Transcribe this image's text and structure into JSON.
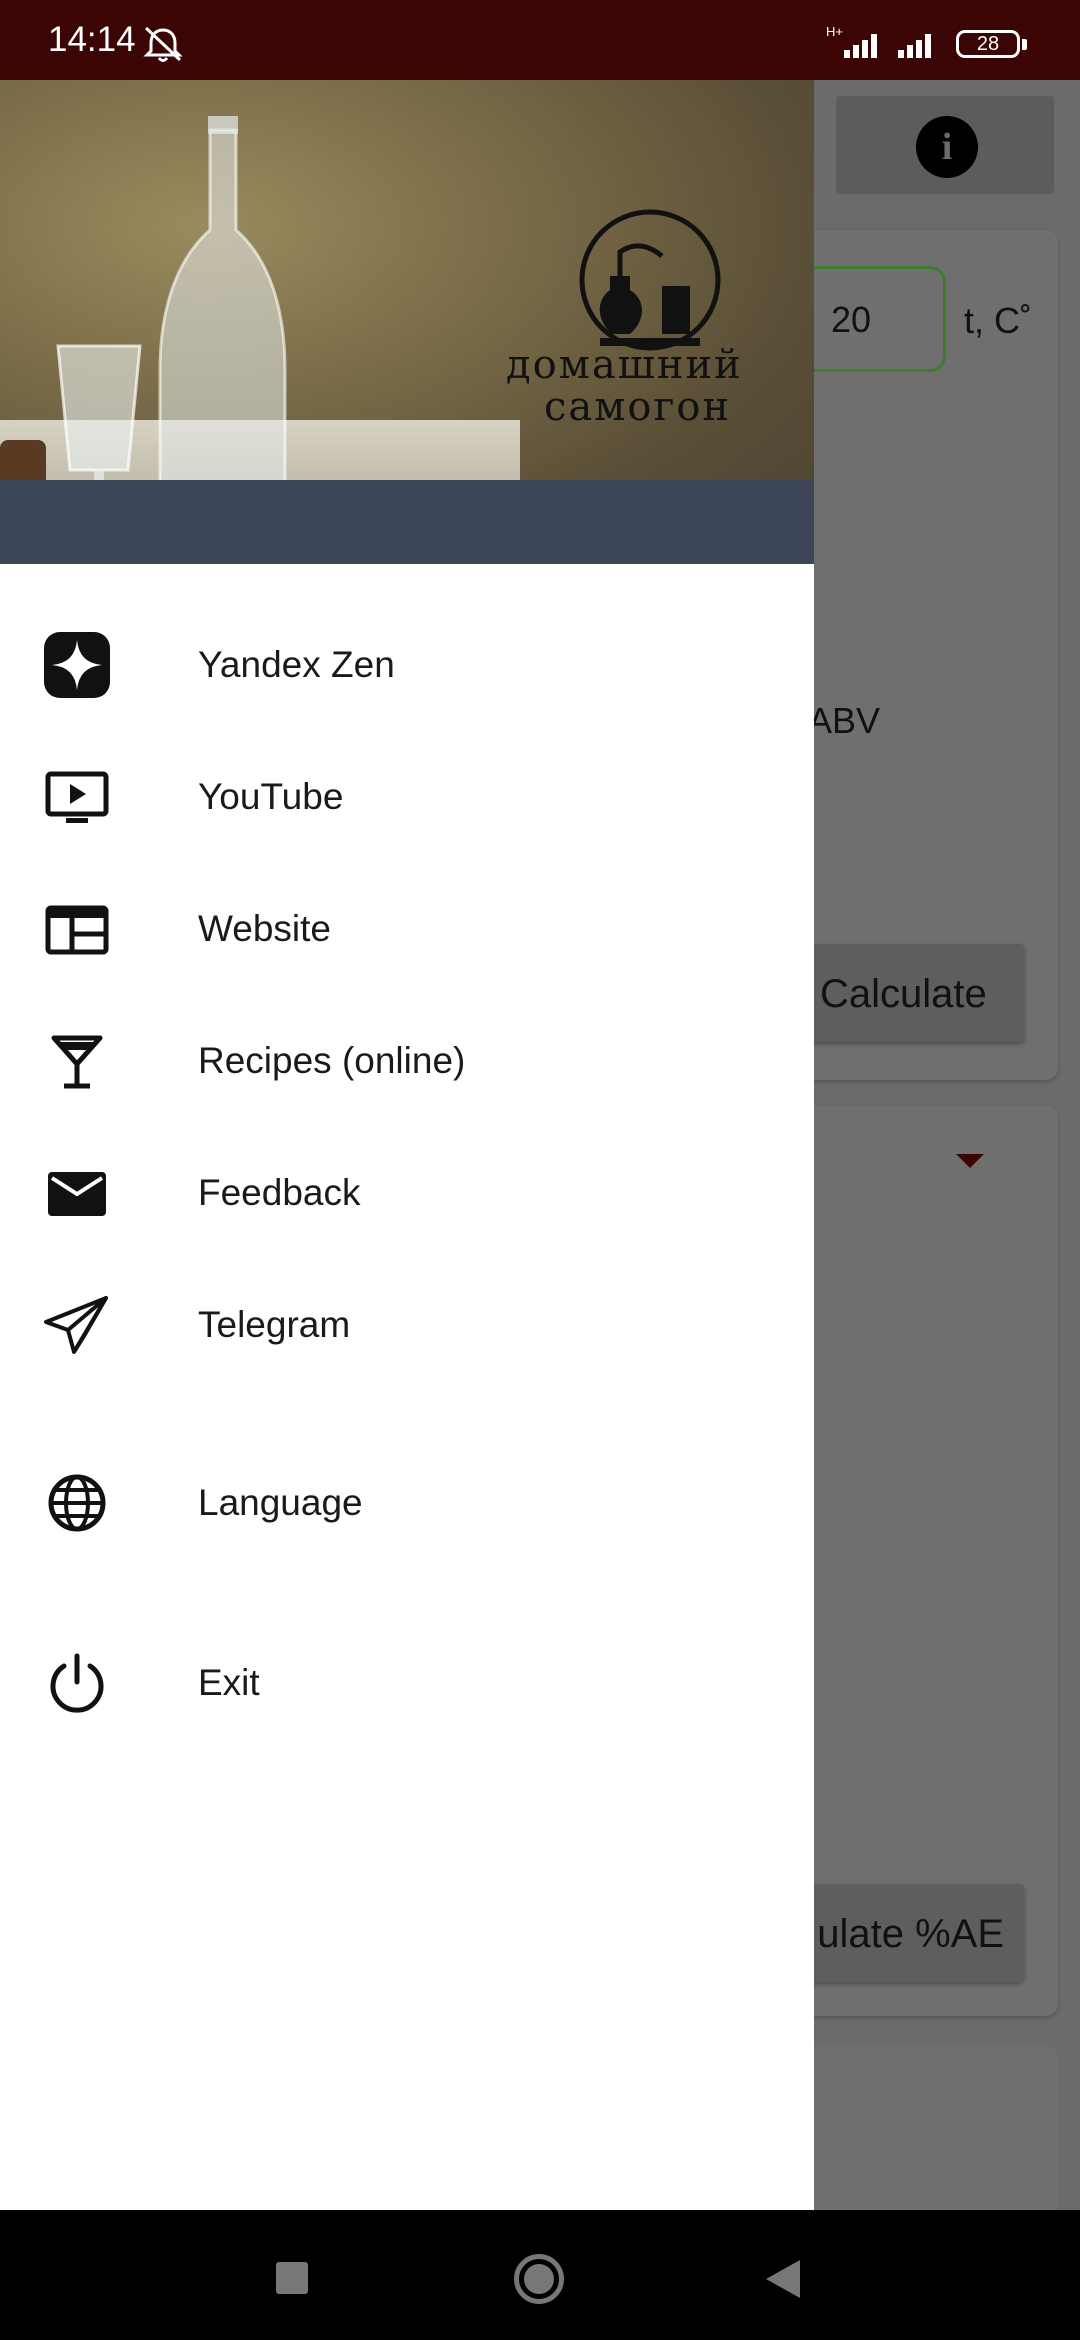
{
  "status_bar": {
    "time": "14:14",
    "network_label": "H+",
    "battery": "28"
  },
  "background_app": {
    "temperature_value": "20",
    "temperature_unit": "t, C˚",
    "abv_label": "ABV",
    "calculate_label": "Calculate",
    "calculate_ae_label": "ulate %AE"
  },
  "drawer": {
    "logo_line1": "домашний",
    "logo_line2": "самогон",
    "items": [
      {
        "label": "Yandex Zen",
        "icon": "yandex-zen-icon"
      },
      {
        "label": "YouTube",
        "icon": "youtube-icon"
      },
      {
        "label": "Website",
        "icon": "website-icon"
      },
      {
        "label": "Recipes (online)",
        "icon": "cocktail-glass-icon"
      },
      {
        "label": "Feedback",
        "icon": "mail-icon"
      },
      {
        "label": "Telegram",
        "icon": "telegram-icon"
      },
      {
        "label": "Language",
        "icon": "globe-icon"
      },
      {
        "label": "Exit",
        "icon": "power-icon"
      }
    ]
  },
  "colors": {
    "status_bar": "#3a0504",
    "accent_green": "#3e7d2d",
    "scrim": "#6b6b6b"
  }
}
